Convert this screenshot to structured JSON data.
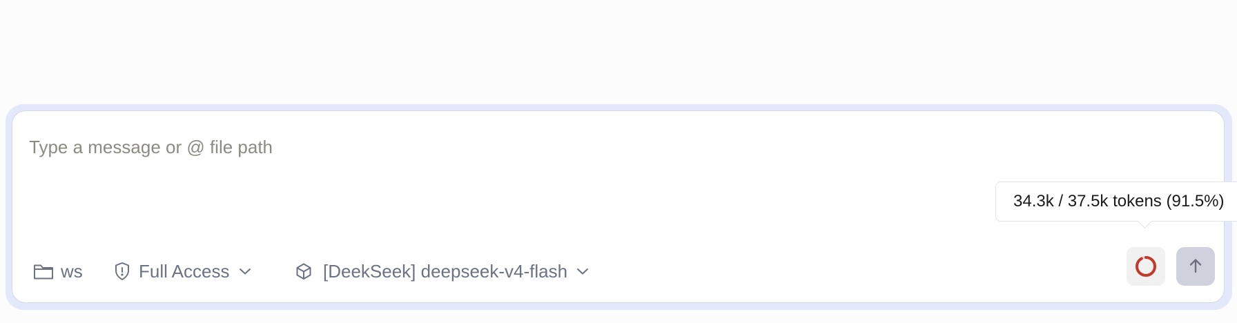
{
  "composer": {
    "placeholder": "Type a message or @ file path"
  },
  "toolbar": {
    "workspace": {
      "icon": "folder-icon",
      "label": "ws"
    },
    "access": {
      "icon": "shield-alert-icon",
      "label": "Full Access"
    },
    "model": {
      "icon": "cube-icon",
      "label": "[DeekSeek] deepseek-v4-flash"
    }
  },
  "context": {
    "tooltip": "34.3k / 37.5k tokens (91.5%)",
    "usage_fraction": 0.915,
    "ring_color": "#c0392b",
    "ring_track_color": "#f3d0cc"
  },
  "send": {
    "icon": "arrow-up-icon"
  },
  "colors": {
    "accent_halo": "#e3e8fb",
    "muted_text": "#6b7282",
    "placeholder": "#8c8b82"
  }
}
